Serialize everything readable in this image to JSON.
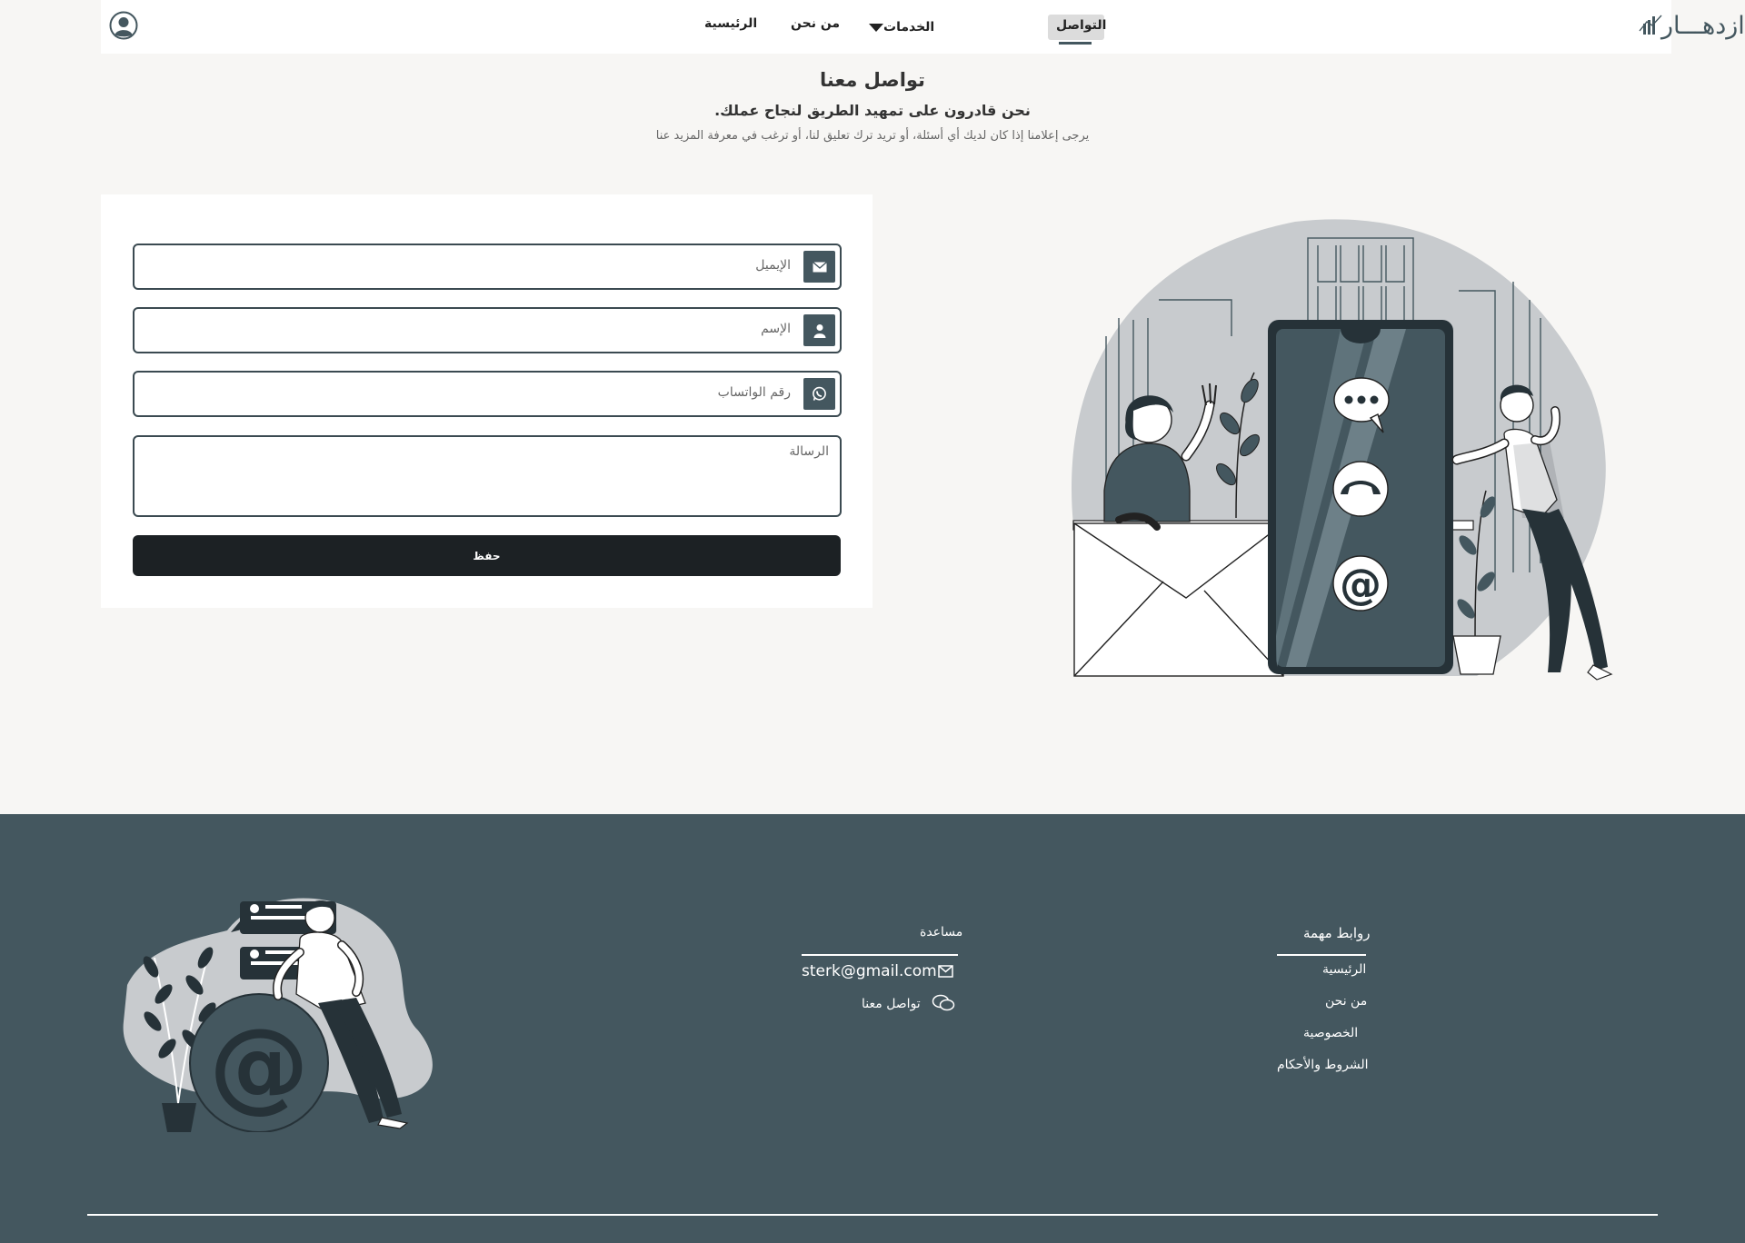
{
  "header": {
    "logo_text": "ازدهـــار",
    "nav": {
      "contact": "التواصل",
      "services": "الخدمات",
      "about": "من نحن",
      "home": "الرئيسية"
    }
  },
  "hero": {
    "title": "تواصل معنا",
    "subtitle": "نحن قادرون على تمهيد الطريق لنجاح عملك.",
    "description": "يرجى إعلامنا إذا كان لديك أي أسئلة، أو تريد ترك تعليق لنا، أو ترغب في معرفة المزيد عنا"
  },
  "form": {
    "email_placeholder": "الإيميل",
    "name_placeholder": "الإسم",
    "whatsapp_placeholder": "رقم الواتساب",
    "message_placeholder": "الرسالة",
    "submit_label": "حفظ"
  },
  "footer": {
    "links_heading": "روابط مهمة",
    "links": [
      "الرئيسية",
      "من نحن",
      "الخصوصية",
      "الشروط والأحكام"
    ],
    "help_heading": "مساعدة",
    "email": "sterk@gmail.com",
    "contact_link": "تواصل معنا"
  },
  "colors": {
    "primary": "#44575f",
    "dark": "#1c2124",
    "background": "#f7f6f4",
    "illustration_gray": "#c8cbce"
  },
  "icons": [
    "user-circle-icon",
    "envelope-icon",
    "user-icon",
    "whatsapp-icon",
    "chat-icon",
    "phone-icon",
    "at-icon"
  ]
}
